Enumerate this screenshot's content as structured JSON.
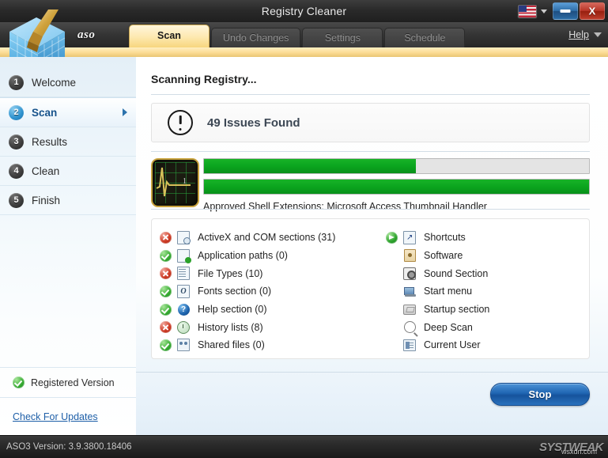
{
  "window": {
    "title": "Registry Cleaner",
    "language_icon": "us-flag-icon",
    "minimize_label": "",
    "close_label": "X"
  },
  "header": {
    "brand": "aso",
    "help_label": "Help",
    "tabs": [
      {
        "label": "Scan",
        "active": true
      },
      {
        "label": "Undo Changes",
        "active": false
      },
      {
        "label": "Settings",
        "active": false
      },
      {
        "label": "Schedule",
        "active": false
      }
    ]
  },
  "sidebar": {
    "items": [
      {
        "number": "1",
        "label": "Welcome",
        "active": false
      },
      {
        "number": "2",
        "label": "Scan",
        "active": true
      },
      {
        "number": "3",
        "label": "Results",
        "active": false
      },
      {
        "number": "4",
        "label": "Clean",
        "active": false
      },
      {
        "number": "5",
        "label": "Finish",
        "active": false
      }
    ],
    "registered_label": "Registered Version",
    "updates_link": "Check For Updates"
  },
  "main": {
    "page_title": "Scanning Registry...",
    "issues_banner": {
      "icon": "exclamation-icon",
      "text": "49 Issues Found",
      "count": 49
    },
    "progress": {
      "overall_percent": 55,
      "current_percent": 100,
      "status_text": "Approved Shell Extensions: Microsoft Access Thumbnail Handler"
    },
    "checklist_left": [
      {
        "status": "error",
        "icon": "activex-icon",
        "label": "ActiveX and COM sections (31)",
        "count": 31
      },
      {
        "status": "ok",
        "icon": "app-paths-icon",
        "label": "Application paths (0)",
        "count": 0
      },
      {
        "status": "error",
        "icon": "file-types-icon",
        "label": "File Types (10)",
        "count": 10
      },
      {
        "status": "ok",
        "icon": "fonts-icon",
        "label": "Fonts section (0)",
        "count": 0
      },
      {
        "status": "ok",
        "icon": "help-icon",
        "label": "Help section (0)",
        "count": 0
      },
      {
        "status": "error",
        "icon": "history-icon",
        "label": "History lists (8)",
        "count": 8
      },
      {
        "status": "ok",
        "icon": "shared-files-icon",
        "label": "Shared files (0)",
        "count": 0
      }
    ],
    "checklist_right": [
      {
        "status": "active",
        "icon": "shortcuts-icon",
        "label": "Shortcuts"
      },
      {
        "status": "none",
        "icon": "software-icon",
        "label": "Software"
      },
      {
        "status": "none",
        "icon": "sound-icon",
        "label": "Sound Section"
      },
      {
        "status": "none",
        "icon": "start-menu-icon",
        "label": "Start menu"
      },
      {
        "status": "none",
        "icon": "startup-icon",
        "label": "Startup section"
      },
      {
        "status": "none",
        "icon": "deep-scan-icon",
        "label": "Deep Scan"
      },
      {
        "status": "none",
        "icon": "current-user-icon",
        "label": "Current User"
      }
    ],
    "stop_button": "Stop"
  },
  "statusbar": {
    "version_text": "ASO3 Version: 3.9.3800.18406",
    "watermark": "SYSTWEAK",
    "watermark_sub": "wsxdn.com"
  },
  "colors": {
    "accent_green": "#0ca81e",
    "accent_blue": "#1f65b2",
    "tab_gold": "#fde8ae",
    "error_red": "#cf3c26"
  }
}
